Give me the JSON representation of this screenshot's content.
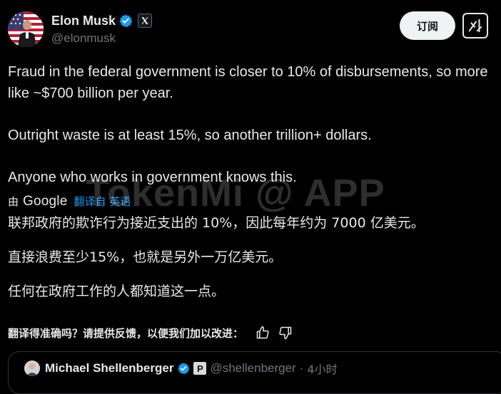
{
  "author": {
    "display_name": "Elon Musk",
    "handle": "@elonmusk",
    "verified_icon": "verified-badge-icon",
    "affiliate_icon": "x-logo-icon"
  },
  "actions": {
    "subscribe_label": "订阅",
    "grok_icon": "grok-icon"
  },
  "post": {
    "paragraphs": [
      "Fraud in the federal government is closer to 10% of disbursements, so more like ~$700 billion per year.",
      "Outright waste is at least 15%, so another trillion+ dollars.",
      "Anyone who works in government knows this."
    ]
  },
  "translation": {
    "prefix": "由",
    "provider": "Google",
    "link": "翻译自 英语",
    "paragraphs": [
      "联邦政府的欺诈行为接近支出的 10%，因此每年约为 7000 亿美元。",
      "直接浪费至少15%，也就是另外一万亿美元。",
      "任何在政府工作的人都知道这一点。"
    ],
    "feedback_question": "翻译得准确吗？请提供反馈，以便我们加以改进：",
    "thumbs_up_icon": "thumbs-up-icon",
    "thumbs_down_icon": "thumbs-down-icon"
  },
  "watermark": "TokenMi @ APP",
  "quoted_post": {
    "display_name": "Michael Shellenberger",
    "badge": "P",
    "handle": "@shellenberger",
    "separator": "·",
    "time": "4小时"
  },
  "colors": {
    "background": "#000000",
    "text": "#e7e9ea",
    "secondary_text": "#71767b",
    "link": "#1d9bf0",
    "verified": "#1d9bf0",
    "border": "#2f3336"
  }
}
